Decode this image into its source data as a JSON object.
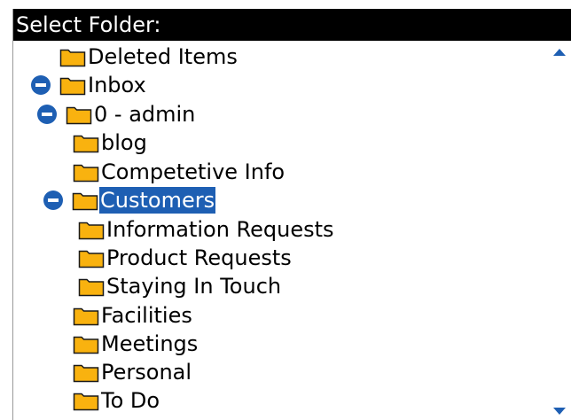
{
  "dialog": {
    "title": "Select Folder:"
  },
  "colors": {
    "title_bar_bg": "#000000",
    "title_bar_text": "#ffffff",
    "selection": "#1e5fb3",
    "folder_fill": "#f9b20f",
    "folder_outline": "#1a1a1a",
    "toggle": "#1e5fb3"
  },
  "folders": [
    {
      "label": "Deleted Items",
      "icon": "folder-icon",
      "toggle": null,
      "selected": false
    },
    {
      "label": "Inbox",
      "icon": "folder-icon",
      "toggle": "collapse-icon",
      "selected": false
    },
    {
      "label": "0 - admin",
      "icon": "folder-icon",
      "toggle": "collapse-icon",
      "selected": false
    },
    {
      "label": "blog",
      "icon": "folder-icon",
      "toggle": null,
      "selected": false
    },
    {
      "label": "Competetive Info",
      "icon": "folder-icon",
      "toggle": null,
      "selected": false
    },
    {
      "label": "Customers",
      "icon": "folder-icon",
      "toggle": "collapse-icon",
      "selected": true
    },
    {
      "label": "Information Requests",
      "icon": "folder-icon",
      "toggle": null,
      "selected": false
    },
    {
      "label": "Product Requests",
      "icon": "folder-icon",
      "toggle": null,
      "selected": false
    },
    {
      "label": "Staying In Touch",
      "icon": "folder-icon",
      "toggle": null,
      "selected": false
    },
    {
      "label": "Facilities",
      "icon": "folder-icon",
      "toggle": null,
      "selected": false
    },
    {
      "label": "Meetings",
      "icon": "folder-icon",
      "toggle": null,
      "selected": false
    },
    {
      "label": "Personal",
      "icon": "folder-icon",
      "toggle": null,
      "selected": false
    },
    {
      "label": "To Do",
      "icon": "folder-icon",
      "toggle": null,
      "selected": false
    }
  ],
  "scroll_indicators": {
    "up": "scroll-up-arrow-icon",
    "down": "scroll-down-arrow-icon"
  }
}
